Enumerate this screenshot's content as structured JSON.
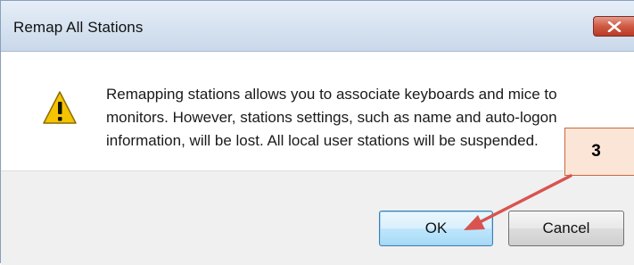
{
  "window": {
    "title": "Remap All Stations",
    "close_icon": "close-icon"
  },
  "dialog": {
    "icon": "warning-icon",
    "message_line1": "Remapping stations allows you to associate keyboards and mice to",
    "message_line2": "monitors. However, stations settings, such as name and auto-logon",
    "message_line3": "information, will be lost. All local user stations will be suspended."
  },
  "buttons": {
    "ok_label": "OK",
    "cancel_label": "Cancel"
  },
  "annotation": {
    "step_number": "3",
    "arrow_color": "#d9534f",
    "callout_fill": "#fbe5d6"
  }
}
